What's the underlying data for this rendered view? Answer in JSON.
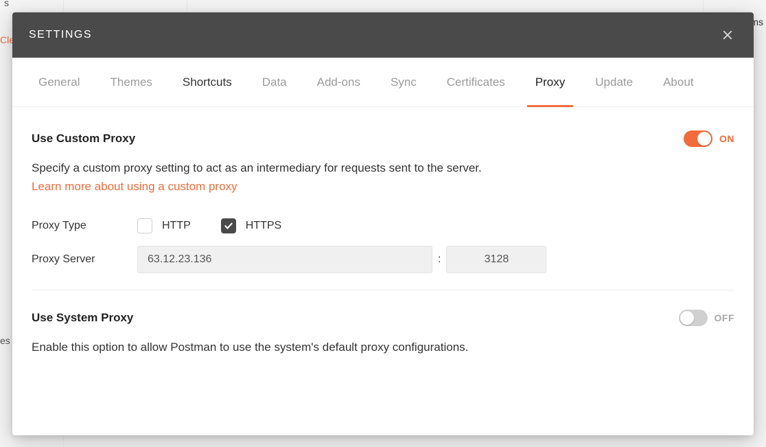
{
  "background": {
    "frag1": "s",
    "frag2": "ms",
    "frag3": "Cle",
    "frag4": " ",
    "frag5": "es"
  },
  "header": {
    "title": "SETTINGS"
  },
  "tabs": [
    {
      "label": "General",
      "active": false,
      "bold": false
    },
    {
      "label": "Themes",
      "active": false,
      "bold": false
    },
    {
      "label": "Shortcuts",
      "active": false,
      "bold": true
    },
    {
      "label": "Data",
      "active": false,
      "bold": false
    },
    {
      "label": "Add-ons",
      "active": false,
      "bold": false
    },
    {
      "label": "Sync",
      "active": false,
      "bold": false
    },
    {
      "label": "Certificates",
      "active": false,
      "bold": false
    },
    {
      "label": "Proxy",
      "active": true,
      "bold": true
    },
    {
      "label": "Update",
      "active": false,
      "bold": false
    },
    {
      "label": "About",
      "active": false,
      "bold": false
    }
  ],
  "custom_proxy": {
    "title": "Use Custom Proxy",
    "toggle_label": "ON",
    "toggle_on": true,
    "description": "Specify a custom proxy setting to act as an intermediary for requests sent to the server.",
    "learn_more": "Learn more about using a custom proxy",
    "proxy_type_label": "Proxy Type",
    "http_label": "HTTP",
    "http_checked": false,
    "https_label": "HTTPS",
    "https_checked": true,
    "proxy_server_label": "Proxy Server",
    "host": "63.12.23.136",
    "port": "3128",
    "separator": ":"
  },
  "system_proxy": {
    "title": "Use System Proxy",
    "toggle_label": "OFF",
    "toggle_on": false,
    "description": "Enable this option to allow Postman to use the system's default proxy configurations."
  }
}
